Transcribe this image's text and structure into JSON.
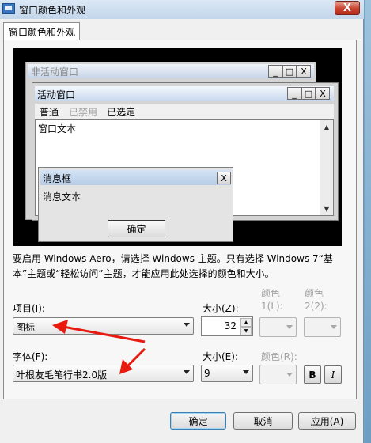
{
  "window": {
    "title": "窗口颜色和外观",
    "close_glyph": "X"
  },
  "tabs": [
    {
      "label": "窗口颜色和外观"
    }
  ],
  "preview": {
    "inactive_title": "非活动窗口",
    "active_title": "活动窗口",
    "menu": {
      "normal": "普通",
      "disabled": "已禁用",
      "selected": "已选定"
    },
    "window_text": "窗口文本",
    "message_title": "消息框",
    "message_text": "消息文本",
    "ok_label": "确定",
    "caption_glyphs": {
      "minimize": "_",
      "maximize": "□",
      "close": "X"
    }
  },
  "info_text": "要启用 Windows Aero，请选择 Windows 主题。只有选择 Windows 7“基本”主题或“轻松访问”主题，才能应用此处选择的颜色和大小。",
  "item": {
    "label": "项目(I):",
    "value": "图标"
  },
  "item_size": {
    "label": "大小(Z):",
    "value": "32"
  },
  "color1": {
    "label_line1": "颜色",
    "label_line2": "1(L):"
  },
  "color2": {
    "label_line1": "颜色",
    "label_line2": "2(2):"
  },
  "font": {
    "label": "字体(F):",
    "value": "叶根友毛笔行书2.0版"
  },
  "font_size": {
    "label": "大小(E):",
    "value": "9"
  },
  "font_color": {
    "label": "颜色(R):"
  },
  "format": {
    "bold": "B",
    "italic": "I"
  },
  "buttons": {
    "ok": "确定",
    "cancel": "取消",
    "apply": "应用(A)"
  },
  "colors": {
    "annotation_arrow": "#e8190f",
    "titlebar": "#c3d6ea",
    "close_button": "#c8432f"
  }
}
